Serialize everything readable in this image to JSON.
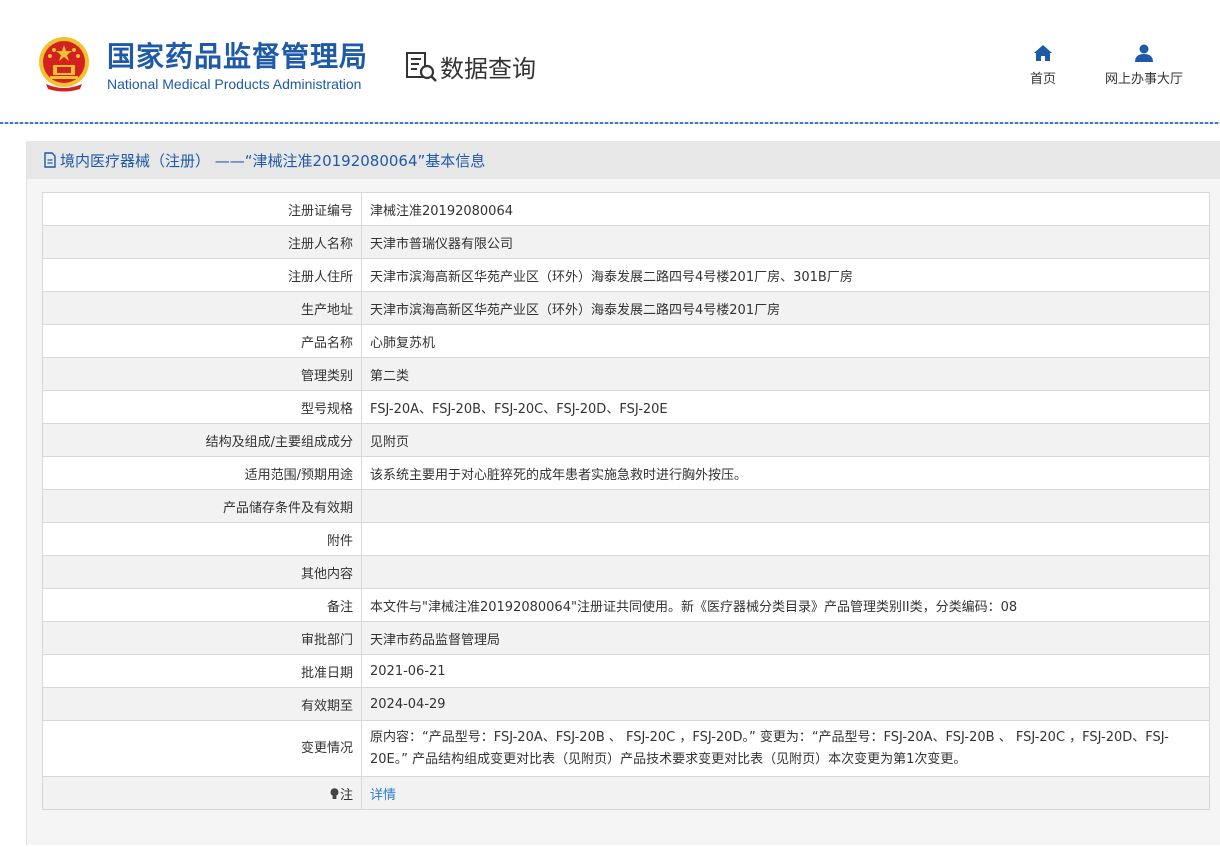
{
  "header": {
    "brand_cn": "国家药品监督管理局",
    "brand_en": "National Medical Products Administration",
    "query_label": "数据查询",
    "nav": [
      {
        "label": "首页",
        "icon": "home-icon"
      },
      {
        "label": "网上办事大厅",
        "icon": "user-icon"
      }
    ]
  },
  "page": {
    "title": "境内医疗器械（注册） ——“津械注准20192080064”基本信息"
  },
  "record": [
    {
      "label": "注册证编号",
      "value": "津械注准20192080064"
    },
    {
      "label": "注册人名称",
      "value": "天津市普瑞仪器有限公司"
    },
    {
      "label": "注册人住所",
      "value": "天津市滨海高新区华苑产业区（环外）海泰发展二路四号4号楼201厂房、301B厂房"
    },
    {
      "label": "生产地址",
      "value": "天津市滨海高新区华苑产业区（环外）海泰发展二路四号4号楼201厂房"
    },
    {
      "label": "产品名称",
      "value": "心肺复苏机"
    },
    {
      "label": "管理类别",
      "value": "第二类"
    },
    {
      "label": "型号规格",
      "value": "FSJ-20A、FSJ-20B、FSJ-20C、FSJ-20D、FSJ-20E"
    },
    {
      "label": "结构及组成/主要组成成分",
      "value": "见附页"
    },
    {
      "label": "适用范围/预期用途",
      "value": "该系统主要用于对心脏猝死的成年患者实施急救时进行胸外按压。"
    },
    {
      "label": "产品储存条件及有效期",
      "value": ""
    },
    {
      "label": "附件",
      "value": ""
    },
    {
      "label": "其他内容",
      "value": ""
    },
    {
      "label": "备注",
      "value": "本文件与\"津械注准20192080064\"注册证共同使用。新《医疗器械分类目录》产品管理类别II类，分类编码：08"
    },
    {
      "label": "审批部门",
      "value": "天津市药品监督管理局"
    },
    {
      "label": "批准日期",
      "value": "2021-06-21"
    },
    {
      "label": "有效期至",
      "value": "2024-04-29"
    },
    {
      "label": "变更情况",
      "value": "原内容：“产品型号：FSJ-20A、FSJ-20B 、 FSJ-20C ，FSJ-20D。” 变更为：“产品型号：FSJ-20A、FSJ-20B 、 FSJ-20C ，FSJ-20D、FSJ-20E。” 产品结构组成变更对比表（见附页）产品技术要求变更对比表（见附页）本次变更为第1次变更。"
    }
  ],
  "note": {
    "label": "注",
    "icon": "lightbulb-icon",
    "link_text": "详情"
  },
  "colors": {
    "brand_blue": "#1e5aa8",
    "link_blue": "#2b7cd3",
    "emblem_red": "#d4201e",
    "emblem_gold": "#f2c230"
  }
}
